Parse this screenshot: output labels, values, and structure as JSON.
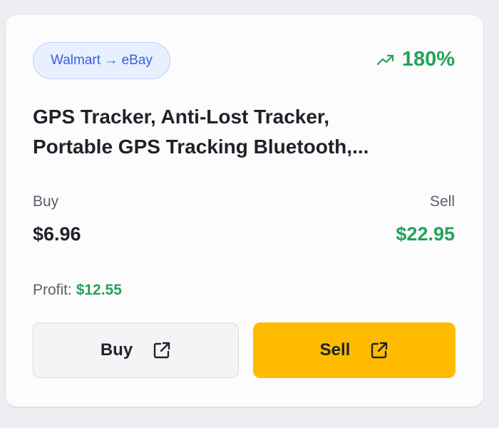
{
  "card": {
    "route": "Walmart → eBay",
    "trend_icon": "trending-up-icon",
    "profit_percent": "180%",
    "title_line1": "GPS Tracker, Anti-Lost Tracker,",
    "title_line2": "Portable GPS Tracking Bluetooth,...",
    "buy_label": "Buy",
    "sell_label": "Sell",
    "buy_price": "$6.96",
    "sell_price": "$22.95",
    "profit_label": "Profit: ",
    "profit_value": "$12.55",
    "buy_button_label": "Buy",
    "sell_button_label": "Sell",
    "external_link_icon": "external-link-icon"
  },
  "colors": {
    "accent_green": "#22a35a",
    "badge_blue": "#3561d8",
    "sell_button": "#ffbb00"
  }
}
